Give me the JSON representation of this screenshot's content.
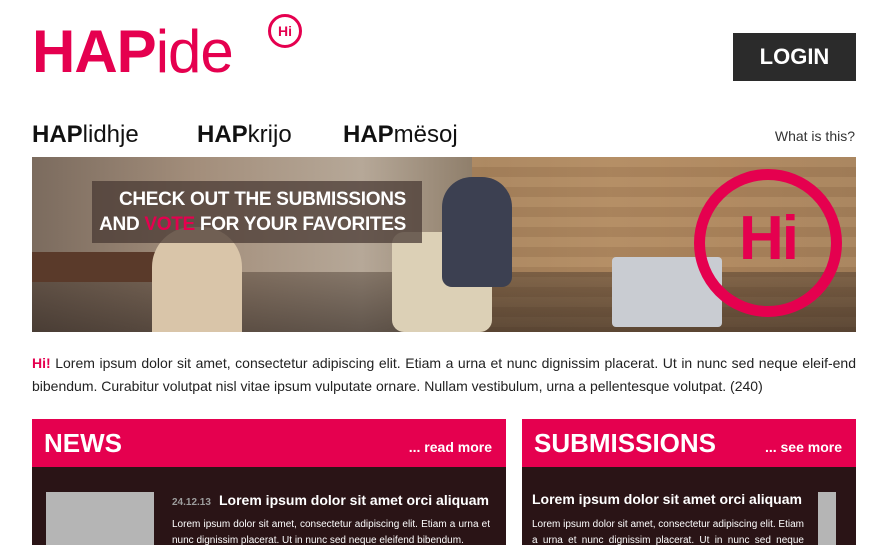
{
  "header": {
    "logo_bold": "HAP",
    "logo_thin": "ide",
    "logo_badge": "Hi",
    "login_label": "LOGIN"
  },
  "nav": {
    "items": [
      {
        "bold": "HAP",
        "rest": "lidhje"
      },
      {
        "bold": "HAP",
        "rest": "krijo"
      },
      {
        "bold": "HAP",
        "rest": "mësoj"
      }
    ],
    "what_is_this": "What is this?"
  },
  "hero": {
    "line1": "CHECK OUT THE  SUBMISSIONS",
    "line2_before": "AND ",
    "line2_highlight": "VOTE",
    "line2_after": " FOR YOUR FAVORITES",
    "badge": "Hi"
  },
  "intro": {
    "lead": "Hi!",
    "text": " Lorem ipsum dolor sit amet, consectetur adipiscing elit. Etiam a urna et nunc dignissim placerat. Ut in nunc sed neque eleif-end bibendum. Curabitur volutpat nisl vitae ipsum vulputate ornare. Nullam vestibulum, urna a pellentesque volutpat. (240)"
  },
  "news": {
    "title": "NEWS",
    "link": "... read more",
    "item": {
      "date": "24.12.13",
      "title": "Lorem ipsum dolor sit amet orci aliquam",
      "text": "Lorem ipsum dolor sit amet, consectetur adipiscing elit. Etiam a urna et nunc dignissim placerat. Ut in nunc sed neque eleifend bibendum."
    }
  },
  "submissions": {
    "title": "SUBMISSIONS",
    "link": "... see more",
    "item": {
      "title": "Lorem ipsum dolor sit amet orci aliquam",
      "text": "Lorem ipsum dolor sit amet, consectetur adipiscing elit. Etiam a urna et nunc dignissim placerat. Ut in nunc sed neque eleifend bibendum."
    }
  },
  "colors": {
    "brand": "#e5004f",
    "dark_panel": "#2a1416",
    "login_bg": "#2b2b2b"
  }
}
